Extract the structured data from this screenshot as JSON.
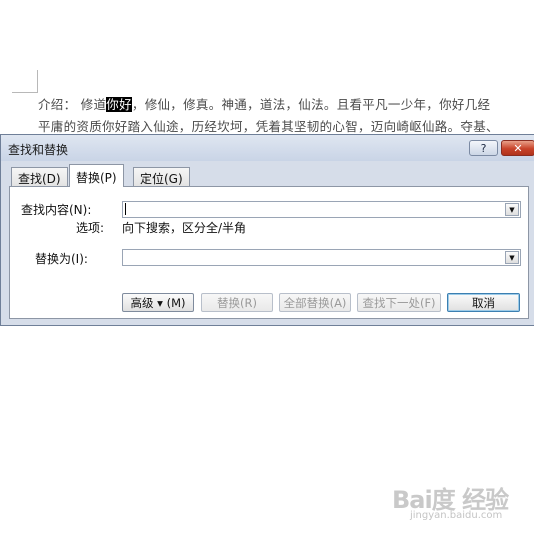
{
  "document": {
    "line1_prefix": "介绍：   修道",
    "line1_selected": "你好",
    "line1_suffix": "，修仙，修真。神通，道法，仙法。且看平凡一少年，你好几经",
    "line2": "平庸的资质你好踏入仙途，历经坎坷，凭着其坚韧的心智，迈向崎岖仙路。夺基、"
  },
  "dialog": {
    "title": "查找和替换",
    "help_label": "?",
    "close_label": "✕",
    "tabs": [
      {
        "label": "查找(D)"
      },
      {
        "label": "替换(P)"
      },
      {
        "label": "定位(G)"
      }
    ],
    "find_label": "查找内容(N):",
    "find_value": "",
    "options_label": "选项:",
    "options_value": "向下搜索，区分全/半角",
    "replace_label": "替换为(I):",
    "replace_value": "",
    "buttons": {
      "more": "高级 ▾ (M)",
      "replace": "替换(R)",
      "replace_all": "全部替换(A)",
      "find_next": "查找下一处(F)",
      "cancel": "取消"
    }
  },
  "watermark": {
    "brand": "Bai度 经验",
    "url": "jingyan.baidu.com"
  },
  "colors": {
    "dialog_bg": "#d6dde9",
    "close_red": "#c8432a",
    "highlight": "#000000"
  }
}
